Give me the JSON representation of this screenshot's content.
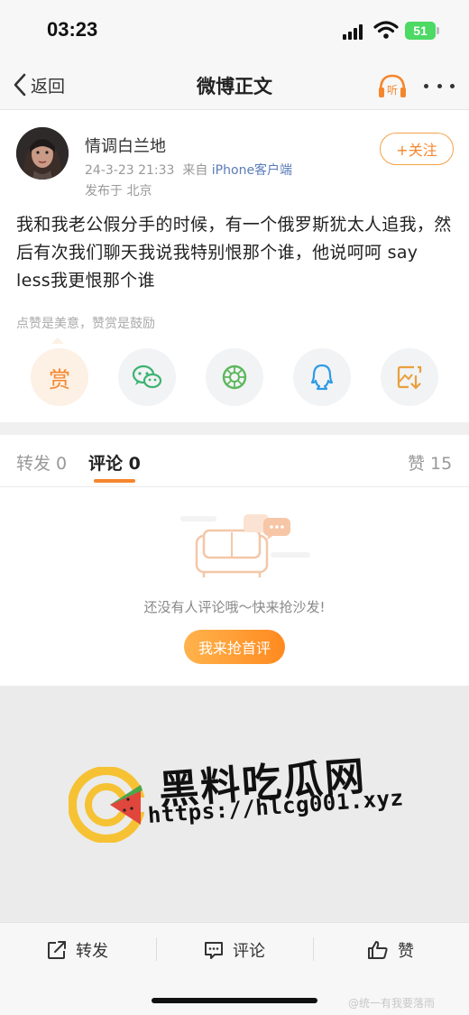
{
  "status_bar": {
    "time": "03:23",
    "battery": "51"
  },
  "nav": {
    "back_label": "返回",
    "title": "微博正文",
    "listen_label": "听"
  },
  "post": {
    "username": "情调白兰地",
    "date": "24-3-23 21:33",
    "source_prefix": "来自",
    "source": "iPhone客户端",
    "location": "发布于 北京",
    "follow_label": "+关注",
    "text": "我和我老公假分手的时候，有一个俄罗斯犹太人追我，然后有次我们聊天我说我特别恨那个谁，他说呵呵 say less我更恨那个谁",
    "reward_hint": "点赞是美意，赞赏是鼓励",
    "reward_label": "赏",
    "share_icons": [
      "reward-icon",
      "wechat-icon",
      "moments-icon",
      "qq-icon",
      "save-image-icon"
    ]
  },
  "tabs": {
    "repost": "转发 0",
    "comment": "评论 0",
    "likes": "赞 15"
  },
  "empty_state": {
    "text": "还没有人评论哦～快来抢沙发!",
    "button": "我来抢首评"
  },
  "watermark": {
    "title": "黑料吃瓜网",
    "url": "https://hlcg001.xyz",
    "source_tag": "@统一有我要落雨"
  },
  "bottom_bar": {
    "repost": "转发",
    "comment": "评论",
    "like": "赞"
  },
  "colors": {
    "accent": "#f5862d",
    "link": "#5b7bb8",
    "wechat": "#3cb371",
    "qq": "#2e9be6"
  }
}
